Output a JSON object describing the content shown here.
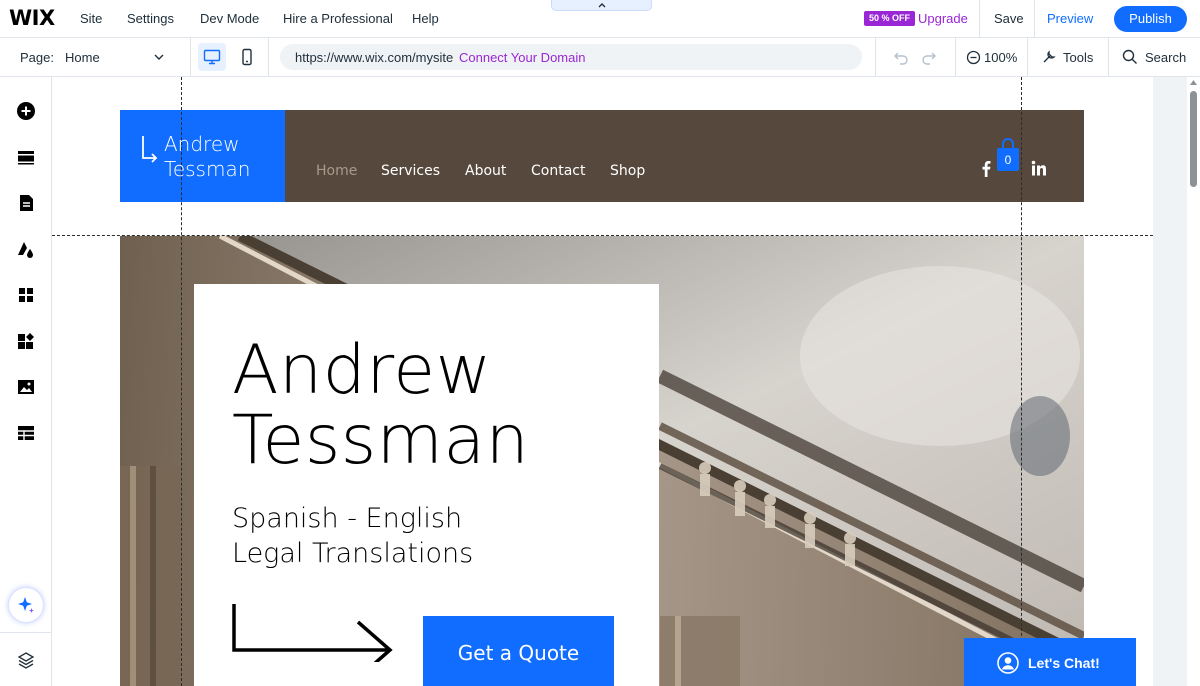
{
  "topbar": {
    "logo": "WIX",
    "menu": [
      "Site",
      "Settings",
      "Dev Mode",
      "Hire a Professional",
      "Help"
    ],
    "promo_badge": "50 % OFF",
    "upgrade": "Upgrade",
    "save": "Save",
    "preview": "Preview",
    "publish": "Publish"
  },
  "secondbar": {
    "page_label": "Page:",
    "page_value": "Home",
    "url": "https://www.wix.com/mysite",
    "connect_domain": "Connect Your Domain",
    "zoom": "100%",
    "tools": "Tools",
    "search": "Search"
  },
  "rail": {
    "icons": [
      "add-elements-icon",
      "sections-icon",
      "pages-icon",
      "site-design-icon",
      "apps-icon",
      "business-apps-icon",
      "media-icon",
      "cms-icon",
      "ai-assistant-icon",
      "layers-icon"
    ]
  },
  "site": {
    "brand_line1": "Andrew",
    "brand_line2": "Tessman",
    "nav": [
      "Home",
      "Services",
      "About",
      "Contact",
      "Shop"
    ],
    "cart_count": "0",
    "hero_name_line1": "Andrew",
    "hero_name_line2": "Tessman",
    "hero_sub_line1": "Spanish - English",
    "hero_sub_line2": "Legal Translations",
    "quote_button": "Get a Quote",
    "chat": "Let's Chat!"
  },
  "colors": {
    "accent": "#116dff",
    "upgrade": "#9a27d5",
    "header_brown": "#56483c"
  }
}
